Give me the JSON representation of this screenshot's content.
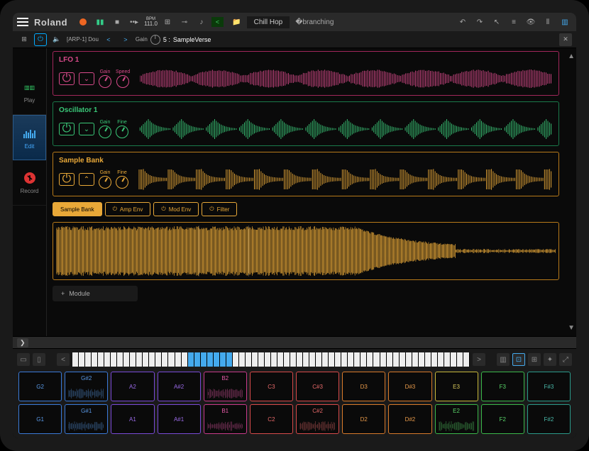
{
  "topbar": {
    "brand": "Roland",
    "bpm_label": "BPM",
    "bpm_value": "111.0",
    "project_name": "Chill Hop"
  },
  "subbar": {
    "preset_name": "[ARP-1] Dou",
    "gain_label": "Gain",
    "patch_number": "5 :",
    "patch_name": "SampleVerse"
  },
  "sidebar": {
    "play": "Play",
    "edit": "Edit",
    "record": "Record"
  },
  "modules": {
    "lfo": {
      "title": "LFO 1",
      "knob1": "Gain",
      "knob2": "Speed"
    },
    "osc": {
      "title": "Oscillator 1",
      "knob1": "Gain",
      "knob2": "Fine"
    },
    "sample": {
      "title": "Sample Bank",
      "knob1": "Gain",
      "knob2": "Fine"
    }
  },
  "tabs": {
    "t1": "Sample Bank",
    "t2": "Amp Env",
    "t3": "Mod Env",
    "t4": "Filter"
  },
  "add_module": "Module",
  "pads": [
    {
      "label": "G2",
      "color": "c-blue"
    },
    {
      "label": "G#2",
      "color": "c-blue",
      "wave": true
    },
    {
      "label": "A2",
      "color": "c-purple"
    },
    {
      "label": "A#2",
      "color": "c-purple"
    },
    {
      "label": "B2",
      "color": "c-magenta",
      "wave": true
    },
    {
      "label": "C3",
      "color": "c-red"
    },
    {
      "label": "C#3",
      "color": "c-red"
    },
    {
      "label": "D3",
      "color": "c-orange"
    },
    {
      "label": "D#3",
      "color": "c-orange"
    },
    {
      "label": "E3",
      "color": "c-yellow"
    },
    {
      "label": "F3",
      "color": "c-green"
    },
    {
      "label": "F#3",
      "color": "c-teal"
    },
    {
      "label": "G1",
      "color": "c-blue"
    },
    {
      "label": "G#1",
      "color": "c-blue",
      "wave": true
    },
    {
      "label": "A1",
      "color": "c-purple"
    },
    {
      "label": "A#1",
      "color": "c-purple"
    },
    {
      "label": "B1",
      "color": "c-magenta",
      "wave": true
    },
    {
      "label": "C2",
      "color": "c-red"
    },
    {
      "label": "C#2",
      "color": "c-red",
      "wave": true
    },
    {
      "label": "D2",
      "color": "c-orange"
    },
    {
      "label": "D#2",
      "color": "c-orange"
    },
    {
      "label": "E2",
      "color": "c-green",
      "wave": true
    },
    {
      "label": "F2",
      "color": "c-green"
    },
    {
      "label": "F#2",
      "color": "c-teal"
    }
  ]
}
